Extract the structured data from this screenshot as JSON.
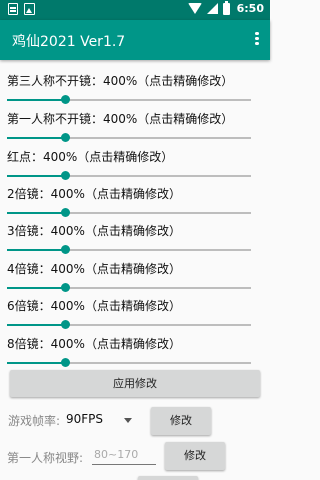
{
  "status_bar": {
    "time": "6:50",
    "left_icons": [
      "notification-icon",
      "image-icon"
    ],
    "right_icons": [
      "wifi-icon",
      "signal-icon",
      "battery-icon"
    ]
  },
  "app_bar": {
    "title": "鸡仙2021 Ver1.7",
    "menu_icon": "more-vert-icon"
  },
  "theme": {
    "accent": "#009688",
    "status_bar": "#00796b",
    "track": "#bdbdbd",
    "button": "#d6d7d7"
  },
  "settings": [
    {
      "label": "第三人称不开镜：400%（点击精确修改）",
      "fraction": 0.24
    },
    {
      "label": "第一人称不开镜：400%（点击精确修改）",
      "fraction": 0.24
    },
    {
      "label": "红点：400%（点击精确修改）",
      "fraction": 0.24
    },
    {
      "label": "2倍镜：400%（点击精确修改）",
      "fraction": 0.24
    },
    {
      "label": "3倍镜：400%（点击精确修改）",
      "fraction": 0.24
    },
    {
      "label": "4倍镜：400%（点击精确修改）",
      "fraction": 0.24
    },
    {
      "label": "6倍镜：400%（点击精确修改）",
      "fraction": 0.24
    },
    {
      "label": "8倍镜：400%（点击精确修改）",
      "fraction": 0.24
    }
  ],
  "apply_button": "应用修改",
  "fps": {
    "label": "游戏帧率:",
    "value": "90FPS",
    "button": "修改"
  },
  "fov": {
    "label": "第一人称视野:",
    "placeholder": "80~170",
    "value": "",
    "button": "修改"
  }
}
